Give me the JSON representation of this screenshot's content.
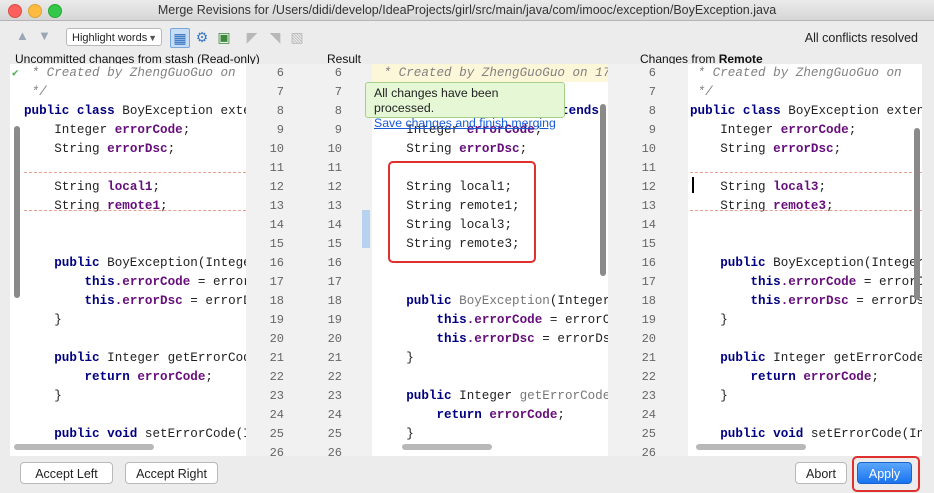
{
  "window": {
    "title": "Merge Revisions for /Users/didi/develop/IdeaProjects/girl/src/main/java/com/imooc/exception/BoyException.java"
  },
  "toolbar": {
    "highlight_select": "Highlight words",
    "status": "All conflicts resolved"
  },
  "panes": {
    "left_header": "Uncommitted changes from stash (Read-only)",
    "center_header": "Result",
    "right_header_prefix": "Changes from ",
    "right_header_bold": "Remote"
  },
  "tooltip": {
    "text": "All changes have been processed.",
    "link": "Save changes and finish merging"
  },
  "gutter": {
    "left_numbers": [
      "6",
      "7",
      "8",
      "9",
      "10",
      "11",
      "12",
      "13",
      "14",
      "15",
      "16",
      "17",
      "18",
      "19",
      "20",
      "21",
      "22",
      "23",
      "24",
      "25",
      "26"
    ],
    "center_numbers": [
      "6",
      "7",
      "8",
      "9",
      "10",
      "11",
      "12",
      "13",
      "14",
      "15",
      "16",
      "17",
      "18",
      "19",
      "20",
      "21",
      "22",
      "23",
      "24",
      "25",
      "26"
    ],
    "right_numbers": [
      "6",
      "7",
      "8",
      "9",
      "10",
      "11",
      "12",
      "13",
      "14",
      "15",
      "16",
      "17",
      "18",
      "19",
      "20",
      "21",
      "22",
      "23",
      "24",
      "25",
      "26"
    ]
  },
  "left_code": {
    "l1": " * Created by ZhengGuoGuo on",
    "l2": " */",
    "l3_kw": "public class",
    "l3_rest": " BoyException exte",
    "l4_type": "    Integer ",
    "l4_f": "errorCode",
    "l5_type": "    String ",
    "l5_f": "errorDsc",
    "l7_type": "    String ",
    "l7_f": "local1",
    "l8_type": "    String ",
    "l8_f": "remote1",
    "l11_kw": "    public",
    "l11_rest": " BoyException(Intege",
    "l12_kw": "        this",
    "l12_f": ".errorCode",
    "l12_rest": " = error",
    "l13_kw": "        this",
    "l13_f": ".errorDsc",
    "l13_rest": " = errorD",
    "l14": "    }",
    "l16_kw": "    public",
    "l16_rest": " Integer getErrorCod",
    "l17_kw": "        return ",
    "l17_f": "errorCode",
    "l18": "    }",
    "l20_kw": "    public void",
    "l20_rest": " setErrorCode(I"
  },
  "center_code": {
    "l1": " * Created by ZhengGuoGuo on 17",
    "l3_rest": "extends",
    "l4_type": "    Integer ",
    "l4_f": "errorCode",
    "l5_type": "    String ",
    "l5_f": "errorDsc",
    "l7": "    String local1;",
    "l8": "    String remote1;",
    "l9": "    String local3;",
    "l10": "    String remote3;",
    "l12_kw": "    public",
    "l12_m": " BoyException",
    "l12_rest": "(Integer e",
    "l13_kw": "        this",
    "l13_f": ".errorCode",
    "l13_rest": " = errorCod",
    "l14_kw": "        this",
    "l14_f": ".errorDsc",
    "l14_rest": " = errorDsc;",
    "l15": "    }",
    "l17_kw": "    public",
    "l17_rest": " Integer ",
    "l17_m": "getErrorCode()",
    "l18_kw": "        return ",
    "l18_f": "errorCode",
    "l19": "    }"
  },
  "right_code": {
    "l1": " * Created by ZhengGuoGuo on",
    "l2": " */",
    "l3_kw": "public class",
    "l3_rest": " BoyException extend",
    "l4_type": "    Integer ",
    "l4_f": "errorCode",
    "l5_type": "    String ",
    "l5_f": "errorDsc",
    "l7_type": "    String ",
    "l7_f": "local3",
    "l8_type": "    String ",
    "l8_f": "remote3",
    "l11_kw": "    public",
    "l11_rest": " BoyException(Integer",
    "l12_kw": "        this",
    "l12_f": ".errorCode",
    "l12_rest": " = errorCo",
    "l13_kw": "        this",
    "l13_f": ".errorDsc",
    "l13_rest": " = errorDsc",
    "l14": "    }",
    "l16_kw": "    public",
    "l16_rest": " Integer getErrorCode(",
    "l17_kw": "        return ",
    "l17_f": "errorCode",
    "l18": "    }",
    "l20_kw": "    public void",
    "l20_rest": " setErrorCode(Int"
  },
  "semicolon": ";",
  "buttons": {
    "accept_left": "Accept Left",
    "accept_right": "Accept Right",
    "abort": "Abort",
    "apply": "Apply"
  },
  "colors": {
    "accent": "#1a73f0",
    "highlight_box": "#e0302d",
    "tooltip_bg": "#e6f7d6"
  }
}
